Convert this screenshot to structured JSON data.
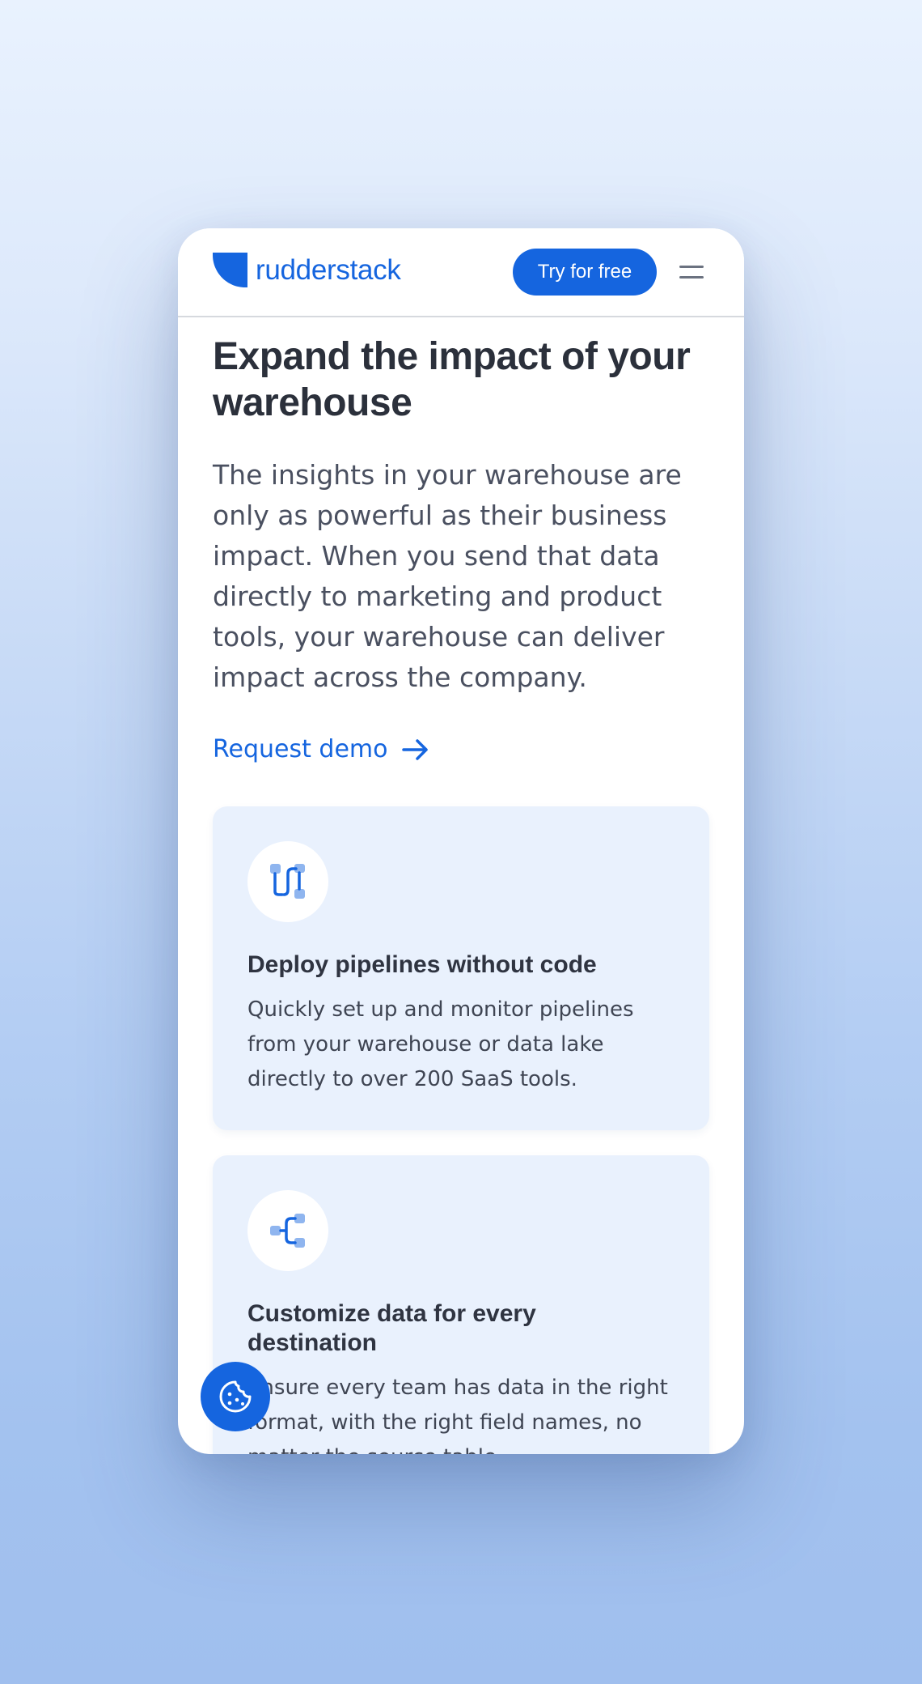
{
  "brand": {
    "name": "rudderstack",
    "color": "#1565df"
  },
  "header": {
    "cta_label": "Try for free",
    "menu_icon": "hamburger-icon"
  },
  "hero": {
    "headline": "Expand the impact of your warehouse",
    "body": "The insights in your warehouse are only as powerful as their business impact. When you send that data directly to marketing and product tools, your warehouse can deliver impact across the company.",
    "link_label": "Request demo",
    "link_icon": "arrow-right-icon"
  },
  "features": [
    {
      "icon": "pipeline-icon",
      "title": "Deploy pipelines without code",
      "body": "Quickly set up and monitor pipelines from your warehouse or data lake directly to over 200 SaaS tools."
    },
    {
      "icon": "branch-icon",
      "title": "Customize data for every destination",
      "body": "Ensure every team has data in the right format, with the right field names, no matter the source table."
    }
  ],
  "cookie_button_icon": "cookie-icon"
}
